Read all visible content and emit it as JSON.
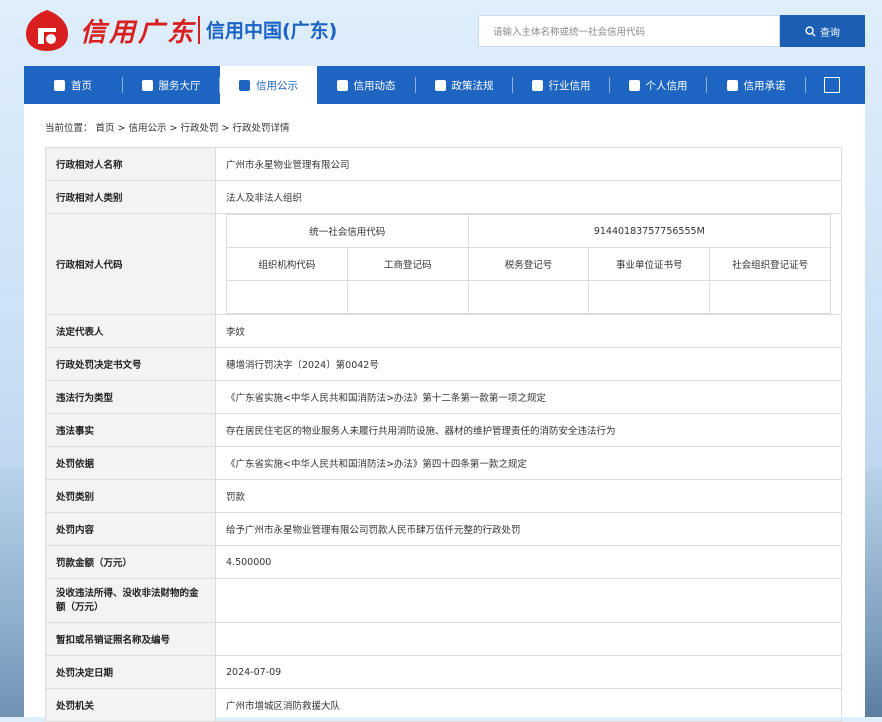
{
  "header": {
    "logo_cn": "信用广东",
    "site_title": "信用中国(广东)",
    "search_placeholder": "请输入主体名称或统一社会信用代码",
    "search_button": "查询"
  },
  "nav": {
    "items": [
      {
        "label": "首页",
        "icon": "home-icon"
      },
      {
        "label": "服务大厅",
        "icon": "grid-icon"
      },
      {
        "label": "信用公示",
        "icon": "bulletin-icon",
        "active": true
      },
      {
        "label": "信用动态",
        "icon": "news-icon"
      },
      {
        "label": "政策法规",
        "icon": "book-icon"
      },
      {
        "label": "行业信用",
        "icon": "building-icon"
      },
      {
        "label": "个人信用",
        "icon": "id-card-icon"
      },
      {
        "label": "信用承诺",
        "icon": "shield-check-icon"
      }
    ],
    "expand_icon": "expand-icon"
  },
  "breadcrumb": {
    "prefix": "当前位置：",
    "items": [
      "首页",
      "信用公示",
      "行政处罚",
      "行政处罚详情"
    ],
    "separator": ">"
  },
  "detail": {
    "name_label": "行政相对人名称",
    "name_value": "广州市永星物业管理有限公司",
    "type_label": "行政相对人类别",
    "type_value": "法人及非法人组织",
    "code_label": "行政相对人代码",
    "uscc_label": "统一社会信用代码",
    "uscc_value": "91440183757756555M",
    "code_headers": [
      "组织机构代码",
      "工商登记码",
      "税务登记号",
      "事业单位证书号",
      "社会组织登记证号"
    ],
    "code_values": [
      "",
      "",
      "",
      "",
      ""
    ],
    "rows": [
      {
        "label": "法定代表人",
        "value": "李妏"
      },
      {
        "label": "行政处罚决定书文号",
        "value": "穗增消行罚决字〔2024〕第0042号"
      },
      {
        "label": "违法行为类型",
        "value": "《广东省实施<中华人民共和国消防法>办法》第十二条第一款第一项之规定"
      },
      {
        "label": "违法事实",
        "value": "存在居民住宅区的物业服务人未履行共用消防设施、器材的维护管理责任的消防安全违法行为"
      },
      {
        "label": "处罚依据",
        "value": "《广东省实施<中华人民共和国消防法>办法》第四十四条第一款之规定"
      },
      {
        "label": "处罚类别",
        "value": "罚款"
      },
      {
        "label": "处罚内容",
        "value": "给予广州市永星物业管理有限公司罚款人民币肆万伍仟元整的行政处罚"
      },
      {
        "label": "罚款金额（万元）",
        "value": "4.500000"
      },
      {
        "label": "没收违法所得、没收非法财物的金额（万元）",
        "value": "",
        "tall": true
      },
      {
        "label": "暂扣或吊销证照名称及编号",
        "value": ""
      },
      {
        "label": "处罚决定日期",
        "value": "2024-07-09"
      },
      {
        "label": "处罚机关",
        "value": "广州市增城区消防救援大队"
      }
    ]
  },
  "colors": {
    "brand_red": "#d81e1e",
    "nav_blue": "#1e64c1",
    "button_blue": "#1a5fb4"
  }
}
